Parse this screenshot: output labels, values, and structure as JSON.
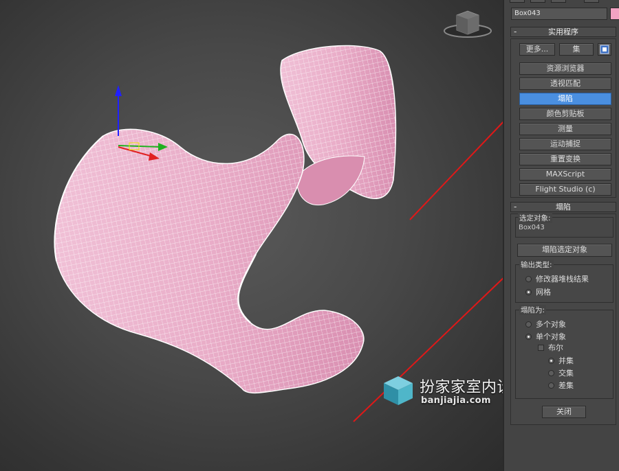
{
  "viewport": {
    "watermark": {
      "title": "扮家家室内设计",
      "url": "banjiajia.com"
    }
  },
  "panel": {
    "object_name": "Box043",
    "object_color": "#f2a3c3",
    "utilities": {
      "header": "实用程序",
      "more_label": "更多...",
      "sets_label": "集",
      "items": [
        "资源浏览器",
        "透视匹配",
        "塌陷",
        "颜色剪贴板",
        "测量",
        "运动捕捉",
        "重置变换",
        "MAXScript",
        "Flight Studio (c)"
      ],
      "active_index": 2
    },
    "collapse": {
      "header": "塌陷",
      "selected_label": "选定对象:",
      "selected_value": "Box043",
      "collapse_button": "塌陷选定对象",
      "output_type_label": "输出类型:",
      "output_options": [
        "修改器堆栈结果",
        "网格"
      ],
      "output_selected": 1,
      "collapse_to_label": "塌陷为:",
      "collapse_to_options": [
        "多个对象",
        "单个对象"
      ],
      "collapse_to_selected": 1,
      "boolean_label": "布尔",
      "boolean_checked": false,
      "boolean_options": [
        "并集",
        "交集",
        "差集"
      ],
      "boolean_selected": 0,
      "close_button": "关闭"
    }
  },
  "colors": {
    "mesh_fill": "#eab3cb",
    "wire": "#ffffff",
    "active_button": "#4a8fe0",
    "arrow": "#e01818"
  }
}
